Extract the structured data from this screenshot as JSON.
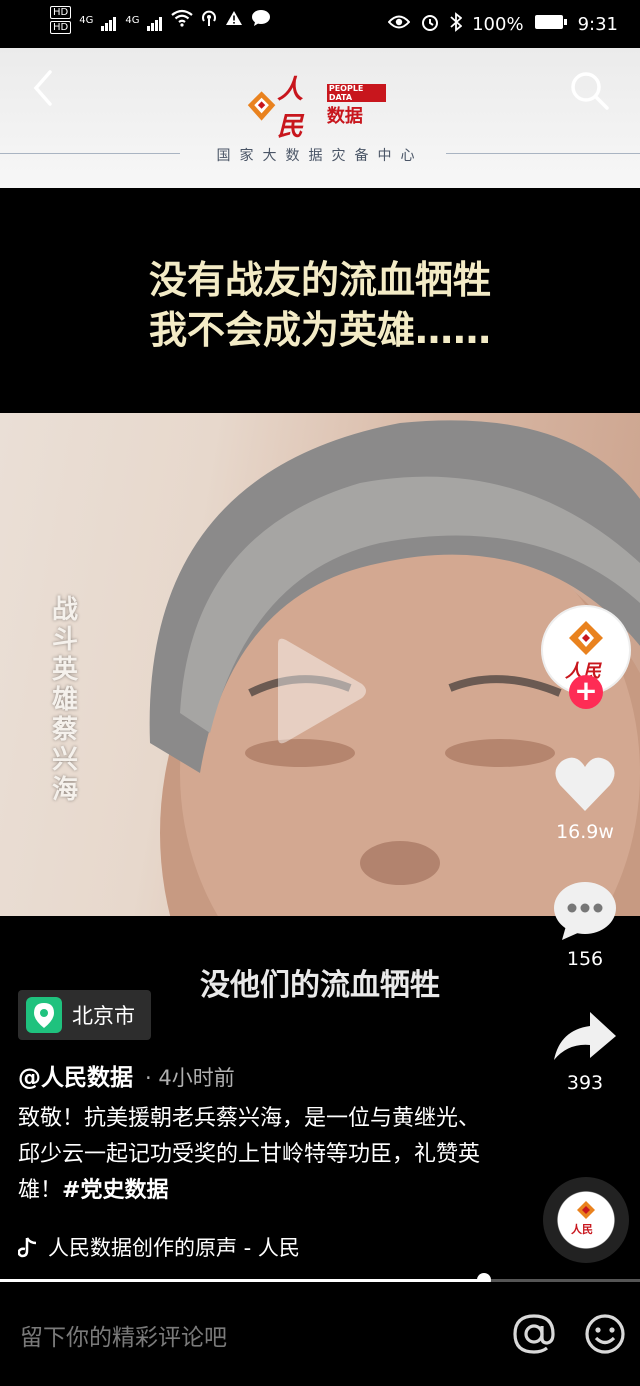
{
  "status_bar": {
    "hd1": "HD",
    "hd2": "HD",
    "network1": "4G",
    "network2": "4G",
    "battery": "100%",
    "time": "9:31"
  },
  "video": {
    "brand_en": "PEOPLE DATA",
    "brand_cn": "人民",
    "brand_cn2": "数据",
    "banner_subtitle": "国家大数据灾备中心",
    "headline_line1": "没有战友的流血牺牲",
    "headline_line2": "我不会成为英雄……",
    "vertical_caption": "战斗英雄 蔡兴海",
    "subtitle": "没他们的流血牺牲",
    "progress": 0.757
  },
  "rail": {
    "like_count": "16.9w",
    "comment_count": "156",
    "share_count": "393",
    "follow_symbol": "+"
  },
  "info": {
    "location": "北京市",
    "author": "@人民数据",
    "time": "· 4小时前",
    "description": "致敬！抗美援朝老兵蔡兴海，是一位与黄继光、邱少云一起记功受奖的上甘岭特等功臣，礼赞英雄！",
    "hashtag": "#党史数据",
    "music": "人民数据创作的原声 - 人民"
  },
  "comment": {
    "placeholder": "留下你的精彩评论吧"
  },
  "colors": {
    "brand_red": "#c8161d",
    "follow_red": "#fe2c55"
  }
}
